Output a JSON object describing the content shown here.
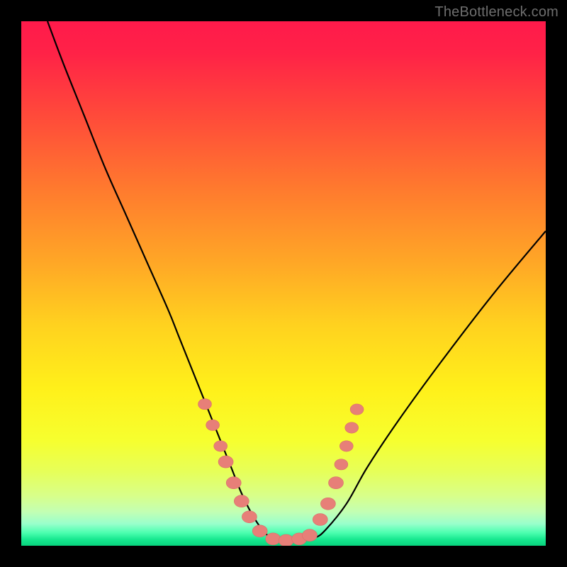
{
  "watermark": {
    "text": "TheBottleneck.com"
  },
  "colors": {
    "background": "#000000",
    "curve": "#000000",
    "marker_fill": "#e77f78",
    "marker_stroke": "#d86f68",
    "gradient_stops": [
      {
        "offset": 0.0,
        "color": "#ff1a4b"
      },
      {
        "offset": 0.06,
        "color": "#ff2247"
      },
      {
        "offset": 0.18,
        "color": "#ff4a3a"
      },
      {
        "offset": 0.32,
        "color": "#ff7a2e"
      },
      {
        "offset": 0.46,
        "color": "#ffa726"
      },
      {
        "offset": 0.58,
        "color": "#ffd21f"
      },
      {
        "offset": 0.7,
        "color": "#fff01a"
      },
      {
        "offset": 0.8,
        "color": "#f6ff2f"
      },
      {
        "offset": 0.86,
        "color": "#e6ff5a"
      },
      {
        "offset": 0.905,
        "color": "#d8ff8a"
      },
      {
        "offset": 0.935,
        "color": "#c3ffb3"
      },
      {
        "offset": 0.958,
        "color": "#99ffcc"
      },
      {
        "offset": 0.975,
        "color": "#4dffb0"
      },
      {
        "offset": 0.988,
        "color": "#17e88f"
      },
      {
        "offset": 1.0,
        "color": "#08d47e"
      }
    ]
  },
  "chart_data": {
    "type": "line",
    "title": "",
    "xlabel": "",
    "ylabel": "",
    "xlim": [
      0,
      100
    ],
    "ylim": [
      0,
      100
    ],
    "series": [
      {
        "name": "bottleneck-curve",
        "x": [
          5,
          8,
          12,
          16,
          20,
          24,
          28,
          30,
          32,
          34,
          36,
          38,
          40,
          42,
          44,
          46,
          48,
          50,
          52,
          54,
          56,
          58,
          62,
          66,
          72,
          80,
          90,
          100
        ],
        "y": [
          100,
          92,
          82,
          72,
          63,
          54,
          45,
          40,
          35,
          30,
          25,
          20,
          15,
          10,
          6,
          3,
          1.2,
          0.8,
          0.8,
          1.0,
          1.5,
          3,
          8,
          15,
          24,
          35,
          48,
          60
        ]
      }
    ],
    "markers": [
      {
        "name": "left-cluster",
        "shape": "pill",
        "points": [
          {
            "x": 35.0,
            "y": 27,
            "r": 9
          },
          {
            "x": 36.5,
            "y": 23,
            "r": 9
          },
          {
            "x": 38.0,
            "y": 19,
            "r": 9
          },
          {
            "x": 39.0,
            "y": 16,
            "r": 10
          },
          {
            "x": 40.5,
            "y": 12,
            "r": 10
          },
          {
            "x": 42.0,
            "y": 8.5,
            "r": 10
          },
          {
            "x": 43.5,
            "y": 5.5,
            "r": 10
          }
        ]
      },
      {
        "name": "bottom-cluster",
        "shape": "pill",
        "points": [
          {
            "x": 45.5,
            "y": 2.8,
            "r": 10
          },
          {
            "x": 48.0,
            "y": 1.3,
            "r": 10
          },
          {
            "x": 50.5,
            "y": 1.0,
            "r": 10
          },
          {
            "x": 53.0,
            "y": 1.3,
            "r": 10
          },
          {
            "x": 55.0,
            "y": 2.0,
            "r": 10
          }
        ]
      },
      {
        "name": "right-cluster",
        "shape": "pill",
        "points": [
          {
            "x": 57.0,
            "y": 5.0,
            "r": 10
          },
          {
            "x": 58.5,
            "y": 8.0,
            "r": 10
          },
          {
            "x": 60.0,
            "y": 12.0,
            "r": 10
          },
          {
            "x": 61.0,
            "y": 15.5,
            "r": 9
          },
          {
            "x": 62.0,
            "y": 19.0,
            "r": 9
          },
          {
            "x": 63.0,
            "y": 22.5,
            "r": 9
          },
          {
            "x": 64.0,
            "y": 26.0,
            "r": 9
          }
        ]
      }
    ]
  }
}
